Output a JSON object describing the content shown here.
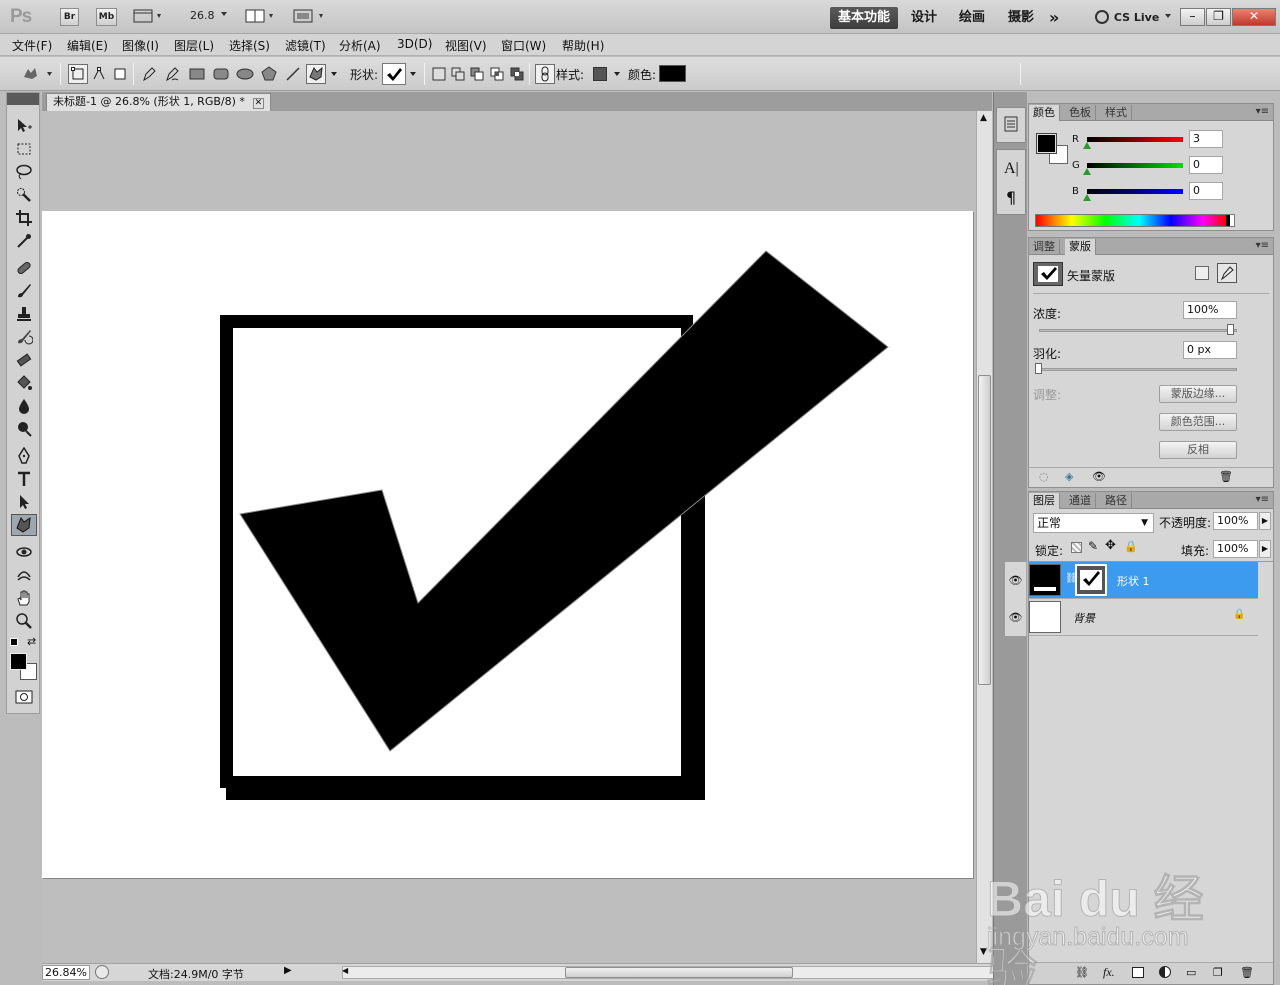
{
  "app": {
    "logo": "Ps",
    "bridge_label": "Br",
    "mini_bridge_label": "Mb",
    "zoom_value": "26.8",
    "workspaces": [
      "基本功能",
      "设计",
      "绘画",
      "摄影"
    ],
    "more_label": "»",
    "cs_live": "CS Live"
  },
  "menu": [
    "文件(F)",
    "编辑(E)",
    "图像(I)",
    "图层(L)",
    "选择(S)",
    "滤镜(T)",
    "分析(A)",
    "3D(D)",
    "视图(V)",
    "窗口(W)",
    "帮助(H)"
  ],
  "options": {
    "shape_label": "形状:",
    "style_label": "样式:",
    "color_label": "颜色:",
    "style_color": "#555555",
    "fill_color": "#000000"
  },
  "document": {
    "tab_title": "未标题-1 @ 26.8% (形状 1, RGB/8) *",
    "status_zoom": "26.84%",
    "status_doc": "文档:24.9M/0 字节"
  },
  "color_panel": {
    "tabs": [
      "颜色",
      "色板",
      "样式"
    ],
    "r_label": "R",
    "g_label": "G",
    "b_label": "B",
    "r_value": "3",
    "g_value": "0",
    "b_value": "0",
    "foreground": "#000000",
    "background": "#ffffff"
  },
  "masks_panel": {
    "tabs": [
      "调整",
      "蒙版"
    ],
    "mask_type": "矢量蒙版",
    "density_label": "浓度:",
    "density_value": "100%",
    "feather_label": "羽化:",
    "feather_value": "0 px",
    "refine_label": "调整:",
    "mask_edge_btn": "蒙版边缘...",
    "color_range_btn": "颜色范围...",
    "invert_btn": "反相"
  },
  "layers_panel": {
    "tabs": [
      "图层",
      "通道",
      "路径"
    ],
    "blend_mode": "正常",
    "opacity_label": "不透明度:",
    "opacity_value": "100%",
    "lock_label": "锁定:",
    "fill_label": "填充:",
    "fill_value": "100%",
    "layers": [
      {
        "name": "形状 1",
        "selected": true
      },
      {
        "name": "背景",
        "selected": false
      }
    ]
  },
  "watermark": {
    "logo": "Bai du 经验",
    "url": "jingyan.baidu.com"
  }
}
